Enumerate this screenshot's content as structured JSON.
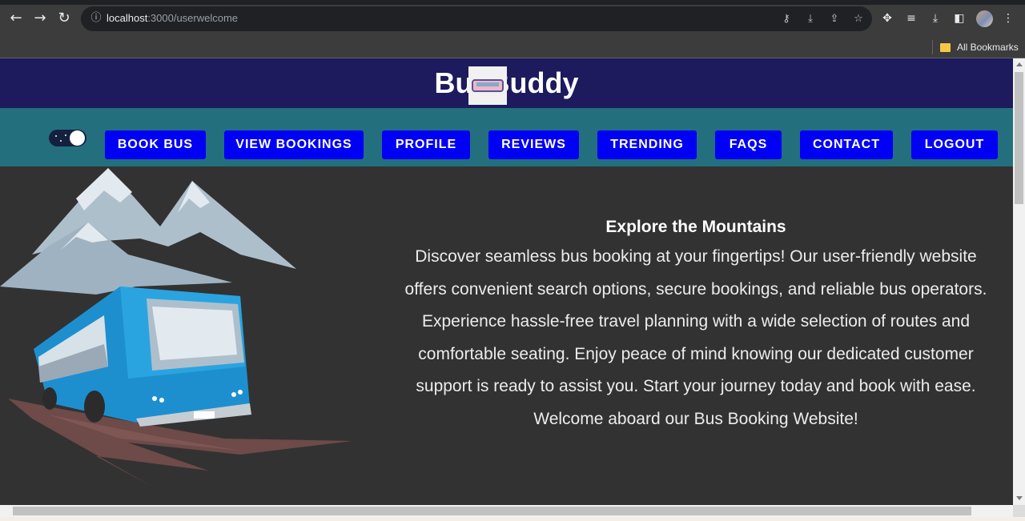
{
  "browser": {
    "url_host": "localhost",
    "url_path": ":3000/userwelcome",
    "bookmarks_folder": "All Bookmarks",
    "icons": [
      "back-arrow-icon",
      "forward-arrow-icon",
      "reload-icon",
      "site-info-icon",
      "key-icon",
      "install-icon",
      "share-icon",
      "star-icon",
      "extensions-icon",
      "reading-list-icon",
      "download-icon",
      "side-panel-icon",
      "profile-avatar",
      "more-menu-icon"
    ]
  },
  "site": {
    "logo_text_left": "Bus",
    "logo_text_right": "Buddy",
    "header_color": "#1d1a5e",
    "nav_color": "#236f7d",
    "button_color": "#0000f5",
    "nav": [
      {
        "label": "BOOK BUS"
      },
      {
        "label": "VIEW BOOKINGS"
      },
      {
        "label": "PROFILE"
      },
      {
        "label": "REVIEWS"
      },
      {
        "label": "TRENDING"
      },
      {
        "label": "FAQS"
      },
      {
        "label": "CONTACT"
      },
      {
        "label": "LOGOUT"
      }
    ],
    "theme_toggle": {
      "state": "on"
    },
    "hero": {
      "title": "Explore the Mountains",
      "lines": [
        "Discover seamless bus booking at your fingertips! Our user-friendly website",
        "offers convenient search options, secure bookings, and reliable bus operators.",
        "Experience hassle-free travel planning with a wide selection of routes and",
        "comfortable seating. Enjoy peace of mind knowing our dedicated customer",
        "support is ready to assist you. Start your journey today and book with ease.",
        "Welcome aboard our Bus Booking Website!"
      ]
    }
  }
}
